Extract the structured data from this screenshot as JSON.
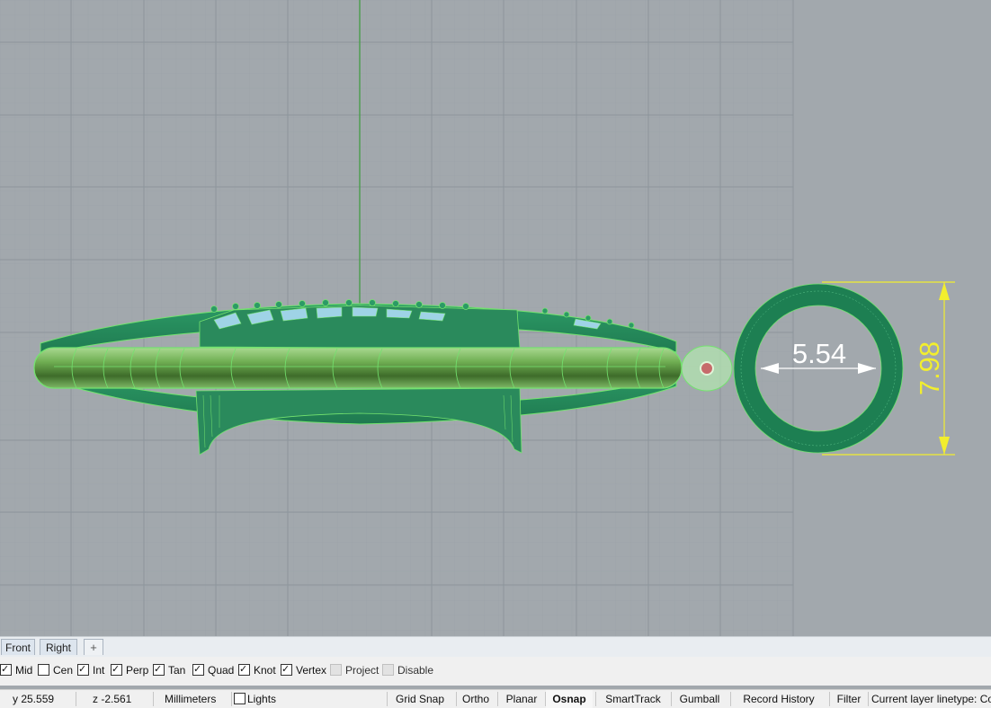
{
  "viewport": {
    "name": "Right",
    "dimensions": [
      {
        "value": "5.54",
        "kind": "diameter",
        "color": "#ffffff"
      },
      {
        "value": "7.98",
        "kind": "linear-vertical",
        "color": "#f2ee2e"
      }
    ],
    "colors": {
      "background": "#a2a8ad",
      "grid_minor": "#98a0a6",
      "grid_major": "#8c949b",
      "axis_z": "#3c9c3c",
      "object": "#1f8a58",
      "selection_wire": "#74e36f",
      "dimension": "#f2ee2e"
    }
  },
  "viewport_tabs": [
    {
      "label": "Front"
    },
    {
      "label": "Right"
    },
    {
      "label": "+",
      "icon": "add-viewport-icon"
    }
  ],
  "osnaps": [
    {
      "label": "Mid",
      "checked": true
    },
    {
      "label": "Cen",
      "checked": false
    },
    {
      "label": "Int",
      "checked": true
    },
    {
      "label": "Perp",
      "checked": true
    },
    {
      "label": "Tan",
      "checked": true
    },
    {
      "label": "Quad",
      "checked": true
    },
    {
      "label": "Knot",
      "checked": true
    },
    {
      "label": "Vertex",
      "checked": true
    },
    {
      "label": "Project",
      "checked": false,
      "disabled": true
    },
    {
      "label": "Disable",
      "checked": false,
      "disabled": true
    }
  ],
  "status": {
    "y": "y 25.559",
    "z": "z -2.561",
    "units": "Millimeters",
    "layer_label": "Lights",
    "buttons": [
      {
        "label": "Grid Snap",
        "active": false
      },
      {
        "label": "Ortho",
        "active": false
      },
      {
        "label": "Planar",
        "active": false
      },
      {
        "label": "Osnap",
        "active": true
      },
      {
        "label": "SmartTrack",
        "active": false
      },
      {
        "label": "Gumball",
        "active": false
      },
      {
        "label": "Record History",
        "active": false
      },
      {
        "label": "Filter",
        "active": false
      }
    ],
    "info": "Current layer linetype: Co"
  }
}
